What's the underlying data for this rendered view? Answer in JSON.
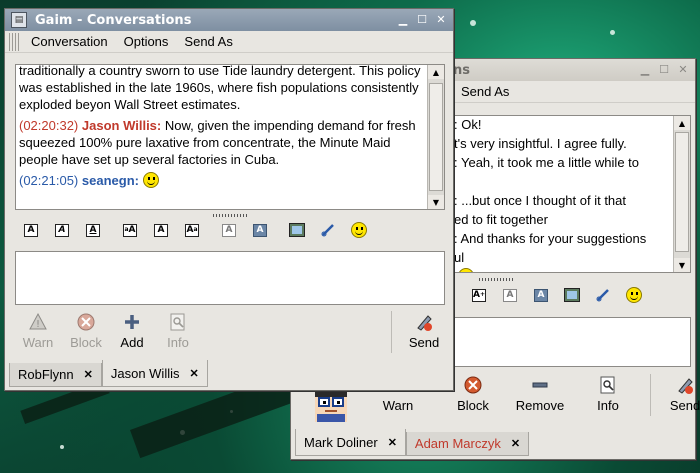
{
  "front_window": {
    "title": "Gaim - Conversations",
    "menu": [
      "Conversation",
      "Options",
      "Send As"
    ],
    "messages": [
      {
        "type": "plain",
        "text": "traditionally a country sworn to use Tide laundry detergent.   This policy was established in the late 1960s, where fish populations consistently exploded beyon Wall Street estimates."
      },
      {
        "type": "msg",
        "timestamp": "(02:20:32)",
        "sender": "Jason Willis:",
        "text": " Now, given the impending demand for fresh squeezed 100% pure laxative from concentrate, the Minute Maid people have set up several factories in Cuba."
      },
      {
        "type": "me",
        "timestamp": "(02:21:05)",
        "sender": "seanegn:",
        "emoticon": "smiley-icon"
      }
    ],
    "actions": [
      {
        "label": "Warn",
        "icon": "warn-icon",
        "enabled": false
      },
      {
        "label": "Block",
        "icon": "block-icon",
        "enabled": false
      },
      {
        "label": "Add",
        "icon": "add-icon",
        "enabled": true
      },
      {
        "label": "Info",
        "icon": "info-icon",
        "enabled": false
      }
    ],
    "send_label": "Send",
    "tabs": [
      {
        "label": "RobFlynn",
        "selected": false
      },
      {
        "label": "Jason Willis",
        "selected": true
      }
    ]
  },
  "back_window": {
    "title_partial": "ns",
    "menu_partial": "Send As",
    "lines": [
      ": Ok!",
      "t's very insightful.  I agree fully.",
      ": Yeah, it took me a little while to",
      "",
      ": ...but once I thought of it that",
      "ed to fit together",
      ": And thanks for your suggestions",
      "ul"
    ],
    "actions": [
      {
        "label": "Warn",
        "icon": "warn-icon"
      },
      {
        "label": "Block",
        "icon": "block-icon"
      },
      {
        "label": "Remove",
        "icon": "remove-icon"
      },
      {
        "label": "Info",
        "icon": "info-icon"
      }
    ],
    "send_label": "Send",
    "tabs": [
      {
        "label": "Mark Doliner",
        "selected": true,
        "color": "#000000"
      },
      {
        "label": "Adam Marczyk",
        "selected": false,
        "color": "#c0392b"
      }
    ]
  }
}
